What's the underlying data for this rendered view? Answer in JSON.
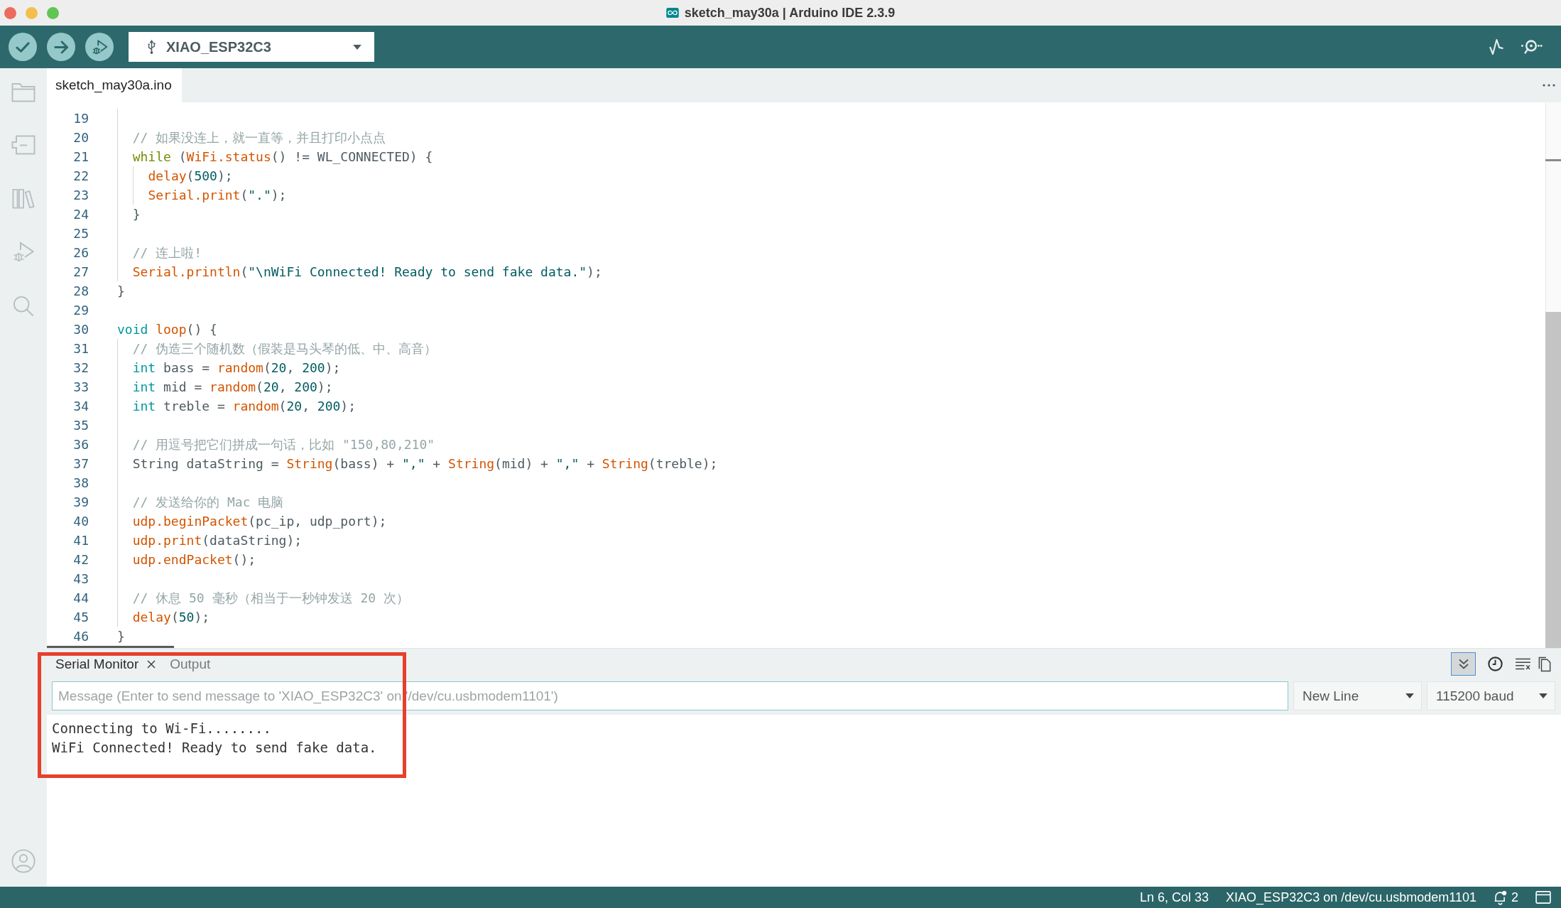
{
  "window": {
    "title": "sketch_may30a | Arduino IDE 2.3.9"
  },
  "toolbar": {
    "buttons": [
      {
        "kind": "verify"
      },
      {
        "kind": "upload"
      },
      {
        "kind": "debug"
      }
    ],
    "board_selector": {
      "value": "XIAO_ESP32C3"
    },
    "right_buttons": [
      {
        "kind": "plotter"
      },
      {
        "kind": "monitor"
      }
    ]
  },
  "sidebar": {
    "items": [
      {
        "kind": "sketchbook",
        "selected": false
      },
      {
        "kind": "boards",
        "selected": false
      },
      {
        "kind": "library",
        "selected": false
      },
      {
        "kind": "debug",
        "selected": false
      },
      {
        "kind": "search",
        "selected": false
      }
    ],
    "footer_items": [
      {
        "kind": "profile"
      }
    ]
  },
  "editor": {
    "tabs": [
      {
        "label": "sketch_may30a.ino",
        "selected": true
      }
    ],
    "lines": [
      {
        "number": "19"
      },
      {
        "number": "20",
        "tokens": [
          {
            "kind": "comment",
            "text": "  // 如果没连上，就一直等，并且打印小点点"
          }
        ]
      },
      {
        "number": "21",
        "tokens": [
          {
            "kind": "control",
            "text": "  while"
          },
          {
            "kind": "plain",
            "text": " ("
          },
          {
            "kind": "function",
            "text": "WiFi.status"
          },
          {
            "kind": "plain",
            "text": "() != WL_CONNECTED) {"
          }
        ]
      },
      {
        "number": "22",
        "tokens": [
          {
            "kind": "function",
            "text": "    delay"
          },
          {
            "kind": "plain",
            "text": "("
          },
          {
            "kind": "number",
            "text": "500"
          },
          {
            "kind": "plain",
            "text": ");"
          }
        ]
      },
      {
        "number": "23",
        "tokens": [
          {
            "kind": "function",
            "text": "    Serial.print"
          },
          {
            "kind": "plain",
            "text": "("
          },
          {
            "kind": "string",
            "text": "\".\""
          },
          {
            "kind": "plain",
            "text": ");"
          }
        ]
      },
      {
        "number": "24",
        "tokens": [
          {
            "kind": "plain",
            "text": "  }"
          }
        ]
      },
      {
        "number": "25"
      },
      {
        "number": "26",
        "tokens": [
          {
            "kind": "comment",
            "text": "  // 连上啦!"
          }
        ]
      },
      {
        "number": "27",
        "tokens": [
          {
            "kind": "function",
            "text": "  Serial.println"
          },
          {
            "kind": "plain",
            "text": "("
          },
          {
            "kind": "string",
            "text": "\"\\nWiFi Connected! Ready to send fake data.\""
          },
          {
            "kind": "plain",
            "text": ");"
          }
        ]
      },
      {
        "number": "28",
        "tokens": [
          {
            "kind": "plain",
            "text": "}"
          }
        ]
      },
      {
        "number": "29"
      },
      {
        "number": "30",
        "tokens": [
          {
            "kind": "type",
            "text": "void"
          },
          {
            "kind": "function",
            "text": " loop"
          },
          {
            "kind": "plain",
            "text": "() {"
          }
        ]
      },
      {
        "number": "31",
        "tokens": [
          {
            "kind": "comment",
            "text": "  // 伪造三个随机数（假装是马头琴的低、中、高音）"
          }
        ]
      },
      {
        "number": "32",
        "tokens": [
          {
            "kind": "type",
            "text": "  int"
          },
          {
            "kind": "plain",
            "text": " bass = "
          },
          {
            "kind": "function",
            "text": "random"
          },
          {
            "kind": "plain",
            "text": "("
          },
          {
            "kind": "number",
            "text": "20"
          },
          {
            "kind": "plain",
            "text": ", "
          },
          {
            "kind": "number",
            "text": "200"
          },
          {
            "kind": "plain",
            "text": ");"
          }
        ]
      },
      {
        "number": "33",
        "tokens": [
          {
            "kind": "type",
            "text": "  int"
          },
          {
            "kind": "plain",
            "text": " mid = "
          },
          {
            "kind": "function",
            "text": "random"
          },
          {
            "kind": "plain",
            "text": "("
          },
          {
            "kind": "number",
            "text": "20"
          },
          {
            "kind": "plain",
            "text": ", "
          },
          {
            "kind": "number",
            "text": "200"
          },
          {
            "kind": "plain",
            "text": ");"
          }
        ]
      },
      {
        "number": "34",
        "tokens": [
          {
            "kind": "type",
            "text": "  int"
          },
          {
            "kind": "plain",
            "text": " treble = "
          },
          {
            "kind": "function",
            "text": "random"
          },
          {
            "kind": "plain",
            "text": "("
          },
          {
            "kind": "number",
            "text": "20"
          },
          {
            "kind": "plain",
            "text": ", "
          },
          {
            "kind": "number",
            "text": "200"
          },
          {
            "kind": "plain",
            "text": ");"
          }
        ]
      },
      {
        "number": "35"
      },
      {
        "number": "36",
        "tokens": [
          {
            "kind": "comment",
            "text": "  // 用逗号把它们拼成一句话，比如 \"150,80,210\""
          }
        ]
      },
      {
        "number": "37",
        "tokens": [
          {
            "kind": "plain",
            "text": "  String dataString = "
          },
          {
            "kind": "function",
            "text": "String"
          },
          {
            "kind": "plain",
            "text": "(bass) + "
          },
          {
            "kind": "string",
            "text": "\",\""
          },
          {
            "kind": "plain",
            "text": " + "
          },
          {
            "kind": "function",
            "text": "String"
          },
          {
            "kind": "plain",
            "text": "(mid) + "
          },
          {
            "kind": "string",
            "text": "\",\""
          },
          {
            "kind": "plain",
            "text": " + "
          },
          {
            "kind": "function",
            "text": "String"
          },
          {
            "kind": "plain",
            "text": "(treble);"
          }
        ]
      },
      {
        "number": "38"
      },
      {
        "number": "39",
        "tokens": [
          {
            "kind": "comment",
            "text": "  // 发送给你的 Mac 电脑"
          }
        ]
      },
      {
        "number": "40",
        "tokens": [
          {
            "kind": "function",
            "text": "  udp.beginPacket"
          },
          {
            "kind": "plain",
            "text": "(pc_ip, udp_port);"
          }
        ]
      },
      {
        "number": "41",
        "tokens": [
          {
            "kind": "function",
            "text": "  udp.print"
          },
          {
            "kind": "plain",
            "text": "(dataString);"
          }
        ]
      },
      {
        "number": "42",
        "tokens": [
          {
            "kind": "function",
            "text": "  udp.endPacket"
          },
          {
            "kind": "plain",
            "text": "();"
          }
        ]
      },
      {
        "number": "43"
      },
      {
        "number": "44",
        "tokens": [
          {
            "kind": "comment",
            "text": "  // 休息 50 毫秒（相当于一秒钟发送 20 次）"
          }
        ]
      },
      {
        "number": "45",
        "tokens": [
          {
            "kind": "function",
            "text": "  delay"
          },
          {
            "kind": "plain",
            "text": "("
          },
          {
            "kind": "number",
            "text": "50"
          },
          {
            "kind": "plain",
            "text": ");"
          }
        ]
      },
      {
        "number": "46",
        "tokens": [
          {
            "kind": "plain",
            "text": "}"
          }
        ]
      }
    ]
  },
  "panel": {
    "tabs": [
      {
        "label": "Serial Monitor",
        "selected": true,
        "closable": true
      },
      {
        "label": "Output",
        "selected": false,
        "closable": false
      }
    ],
    "toggles": [
      {
        "kind": "autoscroll",
        "on": true
      },
      {
        "kind": "timestamp",
        "on": false
      }
    ],
    "actions": [
      {
        "kind": "clear"
      },
      {
        "kind": "copy"
      }
    ],
    "message": {
      "placeholder": "Message (Enter to send message to 'XIAO_ESP32C3' on '/dev/cu.usbmodem1101')"
    },
    "line_ending": {
      "value": "New Line"
    },
    "baud_rate": {
      "value": "115200 baud"
    },
    "output": [
      "Connecting to Wi-Fi........",
      "WiFi Connected! Ready to send fake data."
    ]
  },
  "annotation": {
    "kind": "outline"
  },
  "status_bar": {
    "position": "Ln 6, Col 33",
    "board": "XIAO_ESP32C3 on /dev/cu.usbmodem1101",
    "notifications": "2"
  }
}
